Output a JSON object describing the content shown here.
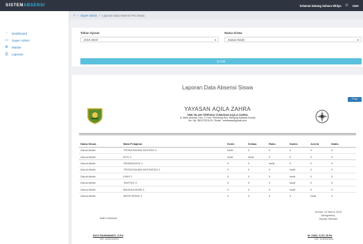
{
  "topbar": {
    "brand_prefix": "SISTEM",
    "brand_main": "ABSENSI",
    "welcome": "Selamat Datang Sahara Widya",
    "user_label": "User"
  },
  "sidebar": {
    "items": [
      {
        "label": "Dashboard",
        "icon": "dashboard-icon"
      },
      {
        "label": "Super Admin",
        "icon": "monitor-icon"
      },
      {
        "label": "Master",
        "icon": "gear-icon"
      },
      {
        "label": "Laporan",
        "icon": "print-icon"
      }
    ]
  },
  "breadcrumb": {
    "first": "Super Admin",
    "second": "Laporan Data Absensi Per Siswa"
  },
  "filter": {
    "year_label": "Tahun Ajaran",
    "year_value": "2019-2020",
    "student_label": "Nama Siswa",
    "student_value": "Zainal Abidin",
    "search_button": "Q Cari"
  },
  "report": {
    "title": "Laporan Data Absensi Siswa",
    "print_button": "Print",
    "org_name": "YAYASAN AQILA ZAHRA",
    "school_name": "SMK ISLAM TERPADU ZUMUDAN AQILA ZAHRA",
    "address": "Jl. Arifin Ahmad, Kec. 17 Kel. Pelintung Kec. Medang Kampai Dumai",
    "contact": "No. Hp. 08127021120 / Email : smkitaaa@gmail.com",
    "columns": [
      "Nama Siswa",
      "Mata Pelajaran",
      "Senin",
      "Selasa",
      "Rabu",
      "Kamis",
      "Jum'at",
      "Sabtu"
    ],
    "rows": [
      [
        "Zainal Abidin",
        "TROBOSAHAN INGGRIS 3",
        "hadir",
        "0",
        "0",
        "0",
        "0",
        "0"
      ],
      [
        "Zainal Abidin",
        "MTK 3",
        "hadir",
        "hadir",
        "0",
        "0",
        "0",
        "0"
      ],
      [
        "Zainal Abidin",
        "SENIBUDAYA 3",
        "0",
        "0",
        "hadir",
        "0",
        "0",
        "0"
      ],
      [
        "Zainal Abidin",
        "TROBOSAHAN INDONESIA 3",
        "0",
        "0",
        "0",
        "hadir",
        "0",
        "0"
      ],
      [
        "Zainal Abidin",
        "KWN 3",
        "0",
        "0",
        "0",
        "hadir",
        "0",
        "0"
      ],
      [
        "Zainal Abidin",
        "TAHFIDZ 3",
        "0",
        "0",
        "0",
        "hadir",
        "0",
        "0"
      ],
      [
        "Zainal Abidin",
        "BAHASA ARAB 3",
        "0",
        "0",
        "0",
        "hadir",
        "0",
        "0"
      ],
      [
        "Zainal Abidin",
        "MENTORING 3",
        "0",
        "0",
        "0",
        "0",
        "hadir",
        "0"
      ]
    ],
    "sign": {
      "date": "Dumai, 10 March 2019",
      "knowing": "Mengetahui,",
      "head_title": "Kepala Sekolah",
      "wali_title": "Wali Kurikulum",
      "left_name": "SUCI RAHMAWATI, S.Pd",
      "left_nip": "NIY. 4190210001",
      "right_name": "M. ZAID, S.ST, M.Pd",
      "right_nip": "NIY. 4190210001"
    }
  }
}
